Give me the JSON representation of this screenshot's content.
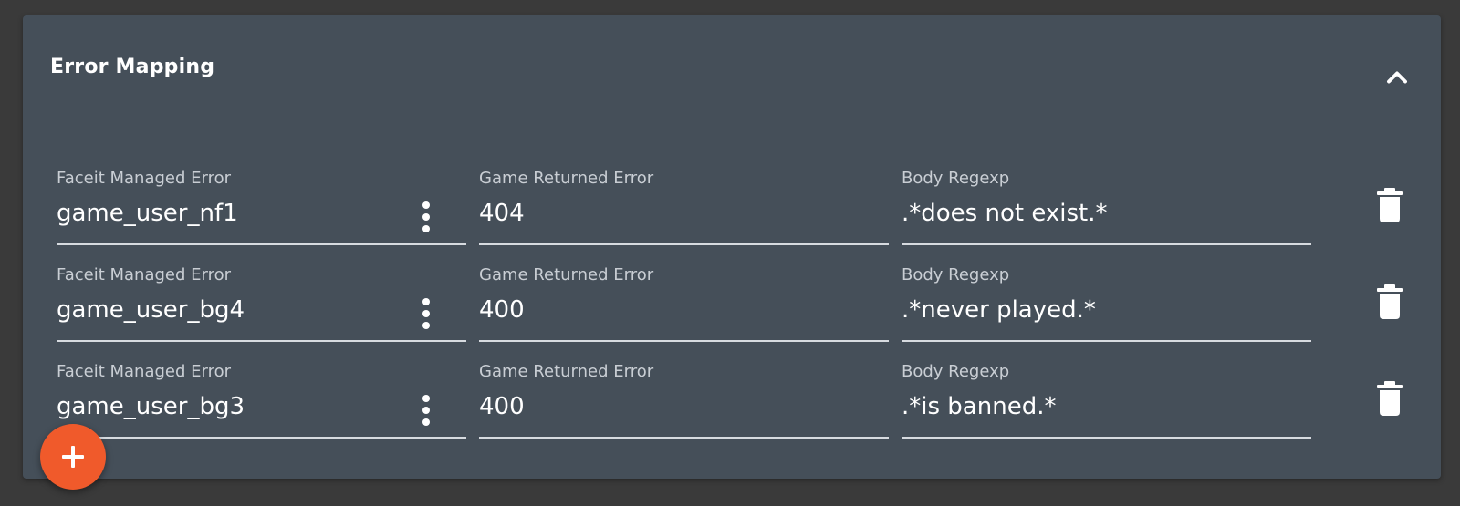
{
  "panel": {
    "title": "Error Mapping",
    "collapse_icon": "chevron-up-icon"
  },
  "columns": {
    "managed_label": "Faceit Managed Error",
    "returned_label": "Game Returned Error",
    "regexp_label": "Body Regexp"
  },
  "rows": [
    {
      "managed": "game_user_nf1",
      "returned": "404",
      "regexp": ".*does not exist.*"
    },
    {
      "managed": "game_user_bg4",
      "returned": "400",
      "regexp": ".*never played.*"
    },
    {
      "managed": "game_user_bg3",
      "returned": "400",
      "regexp": ".*is banned.*"
    }
  ],
  "icons": {
    "row_menu": "more-vertical-icon",
    "row_delete": "trash-icon",
    "add": "plus-icon"
  },
  "colors": {
    "background": "#3a3a3a",
    "panel": "#454f59",
    "accent": "#f05a2b",
    "text": "#ffffff"
  }
}
